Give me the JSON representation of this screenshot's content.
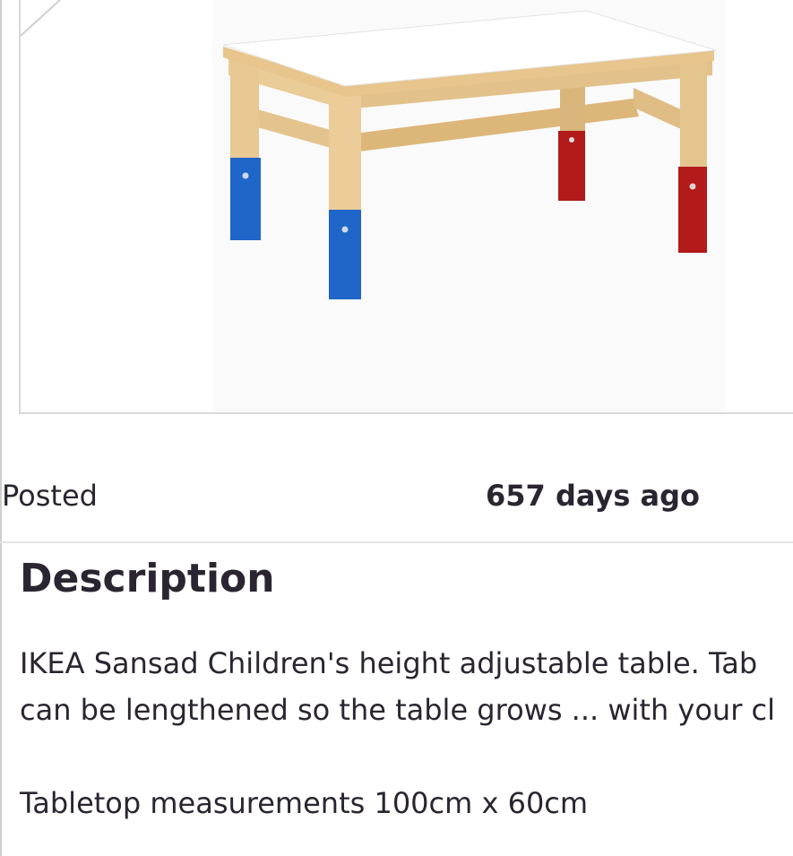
{
  "listing": {
    "image_alt": "IKEA Sansad children's table",
    "posted_label": "Posted",
    "posted_value": "657 days ago"
  },
  "description": {
    "heading": "Description",
    "line1": "IKEA Sansad Children's height adjustable table. Tab",
    "line2": "can be lengthened so the table grows ... with your cl",
    "line3": "Tabletop measurements 100cm x 60cm"
  },
  "colors": {
    "text": "#2a2530",
    "leg_blue": "#1f66c8",
    "leg_red": "#b31a1a",
    "wood": "#e6c690",
    "tabletop": "#ffffff",
    "divider": "#e6e6e6"
  }
}
